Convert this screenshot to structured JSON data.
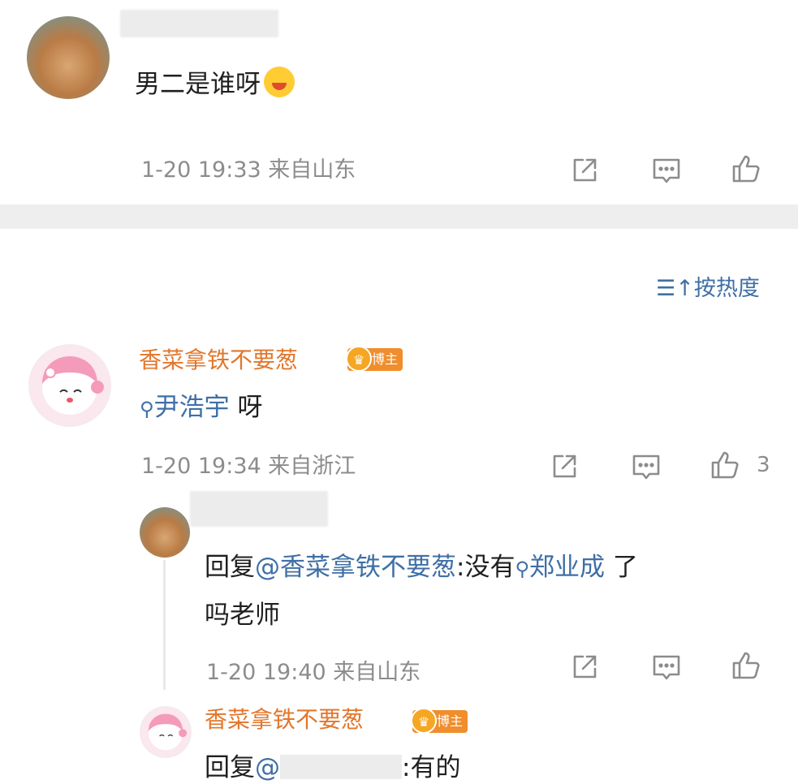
{
  "post": {
    "text": "男二是谁呀",
    "time": "1-20 19:33",
    "location": "来自山东"
  },
  "sort": {
    "label": "按热度"
  },
  "comments": [
    {
      "username": "香菜拿铁不要葱",
      "badge": "博主",
      "topic": "尹浩宇",
      "text_suffix": "呀",
      "time": "1-20 19:34",
      "location": "来自浙江",
      "likes": "3"
    }
  ],
  "replies": [
    {
      "reply_prefix": "回复",
      "mention": "@香菜拿铁不要葱",
      "text_mid": ":没有",
      "topic": "郑业成",
      "text_suffix": "了",
      "text_line2": "吗老师",
      "time": "1-20 19:40",
      "location": "来自山东"
    },
    {
      "username": "香菜拿铁不要葱",
      "badge": "博主",
      "reply_prefix": "回复",
      "mention": "@",
      "text_suffix": ":有的"
    }
  ]
}
